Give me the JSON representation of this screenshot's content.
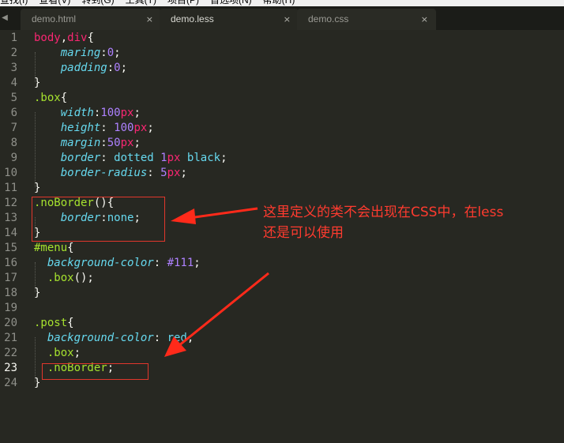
{
  "menubar": {
    "items": [
      "查找(I)",
      "查看(V)",
      "转到(G)",
      "工具(T)",
      "项目(P)",
      "首选项(N)",
      "帮助(H)"
    ]
  },
  "tabs": [
    {
      "label": "demo.html",
      "active": false,
      "close": "×"
    },
    {
      "label": "demo.less",
      "active": true,
      "close": "×"
    },
    {
      "label": "demo.css",
      "active": false,
      "close": "×"
    }
  ],
  "tab_arrows": {
    "left": "◀",
    "right": "▶"
  },
  "editor": {
    "current_line": 23,
    "lines": [
      [
        [
          "t-sel",
          "body"
        ],
        [
          "t-p",
          ","
        ],
        [
          "t-sel",
          "div"
        ],
        [
          "t-p",
          "{"
        ]
      ],
      [
        [
          "t-p",
          "    "
        ],
        [
          "t-prop",
          "maring"
        ],
        [
          "t-p",
          ":"
        ],
        [
          "t-num",
          "0"
        ],
        [
          "t-p",
          ";"
        ]
      ],
      [
        [
          "t-p",
          "    "
        ],
        [
          "t-prop",
          "padding"
        ],
        [
          "t-p",
          ":"
        ],
        [
          "t-num",
          "0"
        ],
        [
          "t-p",
          ";"
        ]
      ],
      [
        [
          "t-p",
          "}"
        ]
      ],
      [
        [
          "t-cls",
          ".box"
        ],
        [
          "t-p",
          "{"
        ]
      ],
      [
        [
          "t-p",
          "    "
        ],
        [
          "t-prop",
          "width"
        ],
        [
          "t-p",
          ":"
        ],
        [
          "t-num",
          "100"
        ],
        [
          "t-unit",
          "px"
        ],
        [
          "t-p",
          ";"
        ]
      ],
      [
        [
          "t-p",
          "    "
        ],
        [
          "t-prop",
          "height"
        ],
        [
          "t-p",
          ": "
        ],
        [
          "t-num",
          "100"
        ],
        [
          "t-unit",
          "px"
        ],
        [
          "t-p",
          ";"
        ]
      ],
      [
        [
          "t-p",
          "    "
        ],
        [
          "t-prop",
          "margin"
        ],
        [
          "t-p",
          ":"
        ],
        [
          "t-num",
          "50"
        ],
        [
          "t-unit",
          "px"
        ],
        [
          "t-p",
          ";"
        ]
      ],
      [
        [
          "t-p",
          "    "
        ],
        [
          "t-prop",
          "border"
        ],
        [
          "t-p",
          ": "
        ],
        [
          "t-kw",
          "dotted"
        ],
        [
          "t-p",
          " "
        ],
        [
          "t-num",
          "1"
        ],
        [
          "t-unit",
          "px"
        ],
        [
          "t-p",
          " "
        ],
        [
          "t-kw",
          "black"
        ],
        [
          "t-p",
          ";"
        ]
      ],
      [
        [
          "t-p",
          "    "
        ],
        [
          "t-prop",
          "border-radius"
        ],
        [
          "t-p",
          ": "
        ],
        [
          "t-num",
          "5"
        ],
        [
          "t-unit",
          "px"
        ],
        [
          "t-p",
          ";"
        ]
      ],
      [
        [
          "t-p",
          "}"
        ]
      ],
      [
        [
          "t-cls",
          ".noBorder"
        ],
        [
          "t-p",
          "(){"
        ]
      ],
      [
        [
          "t-p",
          "    "
        ],
        [
          "t-prop",
          "border"
        ],
        [
          "t-p",
          ":"
        ],
        [
          "t-kw",
          "none"
        ],
        [
          "t-p",
          ";"
        ]
      ],
      [
        [
          "t-p",
          "}"
        ]
      ],
      [
        [
          "t-cls",
          "#menu"
        ],
        [
          "t-p",
          "{"
        ]
      ],
      [
        [
          "t-p",
          "  "
        ],
        [
          "t-prop",
          "background-color"
        ],
        [
          "t-p",
          ": "
        ],
        [
          "t-num",
          "#111"
        ],
        [
          "t-p",
          ";"
        ]
      ],
      [
        [
          "t-p",
          "  "
        ],
        [
          "t-cls",
          ".box"
        ],
        [
          "t-p",
          "();"
        ]
      ],
      [
        [
          "t-p",
          "}"
        ]
      ],
      [],
      [
        [
          "t-cls",
          ".post"
        ],
        [
          "t-p",
          "{"
        ]
      ],
      [
        [
          "t-p",
          "  "
        ],
        [
          "t-prop",
          "background-color"
        ],
        [
          "t-p",
          ": "
        ],
        [
          "t-kw",
          "red"
        ],
        [
          "t-p",
          ";"
        ]
      ],
      [
        [
          "t-p",
          "  "
        ],
        [
          "t-cls",
          ".box"
        ],
        [
          "t-p",
          ";"
        ]
      ],
      [
        [
          "t-p",
          "  "
        ],
        [
          "t-cls",
          ".noBorder"
        ],
        [
          "t-p",
          ";"
        ]
      ],
      [
        [
          "t-p",
          "}"
        ]
      ]
    ]
  },
  "annotation": {
    "line1": "这里定义的类不会出现在CSS中，在less",
    "line2": "还是可以使用",
    "color": "#ff3b2f"
  }
}
